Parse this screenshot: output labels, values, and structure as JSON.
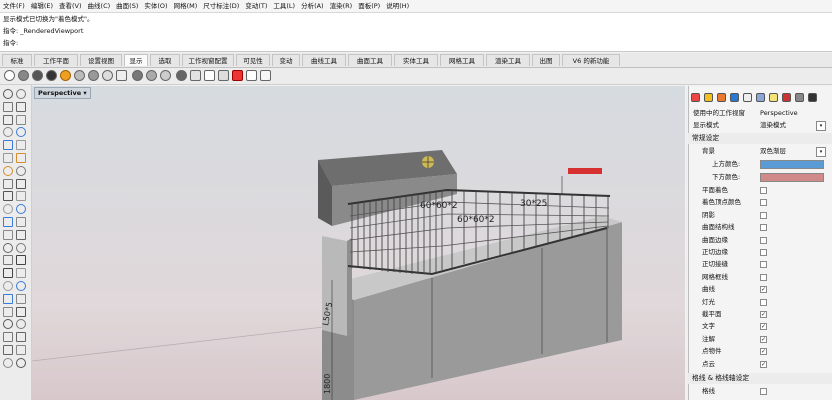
{
  "menu": [
    "文件(F)",
    "编辑(E)",
    "查看(V)",
    "曲线(C)",
    "曲面(S)",
    "实体(O)",
    "网格(M)",
    "尺寸标注(D)",
    "变动(T)",
    "工具(L)",
    "分析(A)",
    "渲染(R)",
    "面板(P)",
    "说明(H)"
  ],
  "command": {
    "line1": "显示模式已切换为\"着色模式\"。",
    "line2": "指令: _RenderedViewport",
    "line3": "指令:"
  },
  "tabs": [
    "标准",
    "工作平面",
    "设置视图",
    "显示",
    "选取",
    "工作视窗配置",
    "可见性",
    "变动",
    "曲线工具",
    "曲面工具",
    "实体工具",
    "网格工具",
    "渲染工具",
    "出图",
    "V6 的新功能"
  ],
  "active_tab": "显示",
  "viewport": {
    "label": "Perspective",
    "annotations": [
      "60*60*2",
      "60*60*2",
      "30*25",
      "L50*5",
      "1800"
    ]
  },
  "panel": {
    "viewport_row": {
      "label": "使用中的工作视窗",
      "value": "Perspective"
    },
    "display_row": {
      "label": "显示模式",
      "value": "渲染模式"
    },
    "general_section": "常规设定",
    "background_row": {
      "label": "背景",
      "value": "双色渐层"
    },
    "top_color_label": "上方颜色:",
    "bottom_color_label": "下方颜色:",
    "top_color": "#5b9bd5",
    "bottom_color": "#d08a8a",
    "options": [
      {
        "label": "平面着色",
        "checked": false
      },
      {
        "label": "着色顶点颜色",
        "checked": false
      },
      {
        "label": "阴影",
        "checked": false
      },
      {
        "label": "曲面结构线",
        "checked": false
      },
      {
        "label": "曲面边缘",
        "checked": false
      },
      {
        "label": "正切边缘",
        "checked": false
      },
      {
        "label": "正切接缝",
        "checked": false
      },
      {
        "label": "网格框线",
        "checked": false
      },
      {
        "label": "曲线",
        "checked": true
      },
      {
        "label": "灯光",
        "checked": false
      },
      {
        "label": "截平面",
        "checked": true
      },
      {
        "label": "文字",
        "checked": true
      },
      {
        "label": "注解",
        "checked": true
      },
      {
        "label": "点物件",
        "checked": true
      },
      {
        "label": "点云",
        "checked": true
      }
    ],
    "grid_section": "格线 & 格线轴设定",
    "grid_row": {
      "label": "格线",
      "checked": false
    }
  }
}
